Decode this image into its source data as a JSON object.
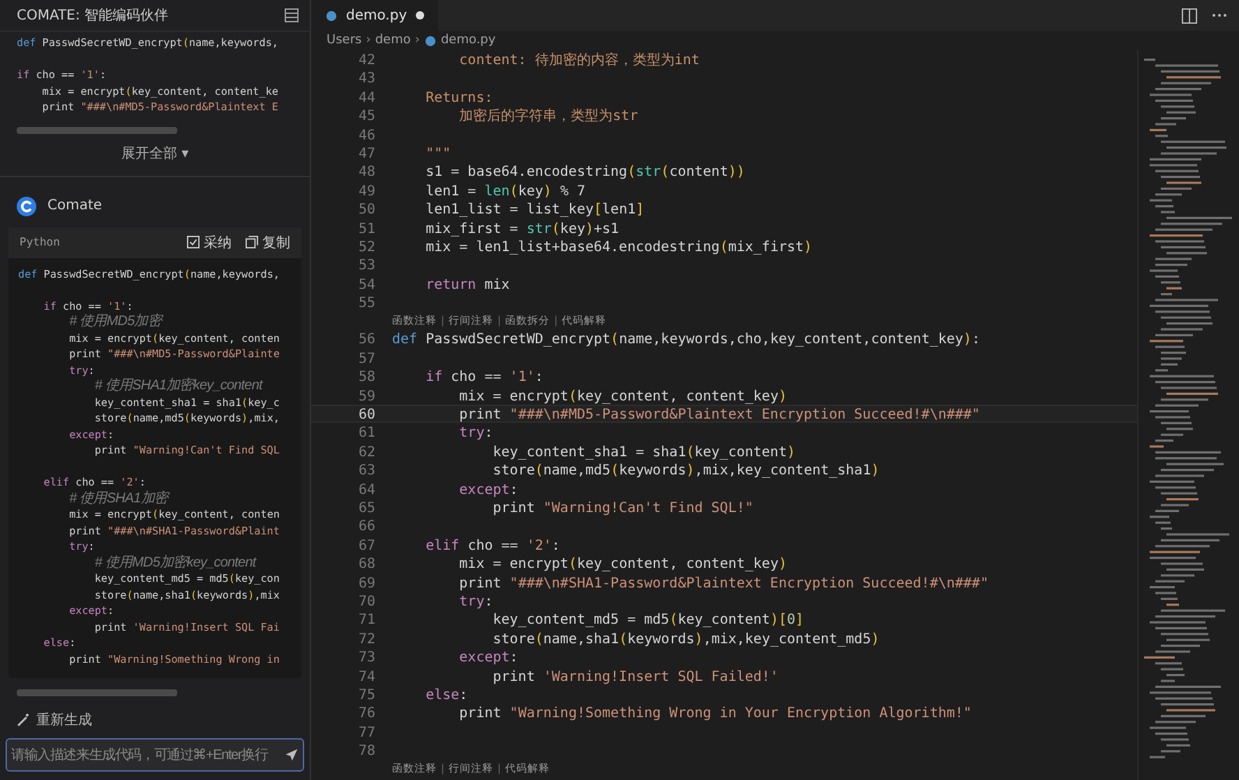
{
  "assistant_panel": {
    "title": "COMATE: 智能编码伙伴",
    "previous_snippet": [
      {
        "kind": "code",
        "tokens": [
          {
            "kind": "def",
            "text": "def"
          },
          {
            "kind": "plain",
            "text": " PasswdSecretWD_encrypt"
          },
          {
            "kind": "paren",
            "text": "("
          },
          {
            "kind": "plain",
            "text": "name,keywords,"
          }
        ]
      },
      {
        "kind": "blank"
      },
      {
        "kind": "code",
        "tokens": [
          {
            "kind": "keyword",
            "text": "if"
          },
          {
            "kind": "plain",
            "text": " cho == "
          },
          {
            "kind": "string",
            "text": "'1'"
          },
          {
            "kind": "plain",
            "text": ":"
          }
        ]
      },
      {
        "kind": "code",
        "tokens": [
          {
            "kind": "plain",
            "text": "    mix = encrypt"
          },
          {
            "kind": "paren",
            "text": "("
          },
          {
            "kind": "plain",
            "text": "key_content, content_ke"
          }
        ]
      },
      {
        "kind": "code",
        "tokens": [
          {
            "kind": "plain",
            "text": "    print "
          },
          {
            "kind": "string",
            "text": "\"###\\n#MD5-Password&Plaintext E"
          }
        ]
      }
    ],
    "expand_label": "展开全部 ▾",
    "reply": {
      "author": "Comate",
      "language": "Python",
      "accept_label": "采纳",
      "copy_label": "复制",
      "lines": [
        {
          "kind": "code",
          "tokens": [
            {
              "kind": "def",
              "text": "def"
            },
            {
              "kind": "plain",
              "text": " PasswdSecretWD_encrypt"
            },
            {
              "kind": "paren",
              "text": "("
            },
            {
              "kind": "plain",
              "text": "name,keywords,"
            }
          ]
        },
        {
          "kind": "blank"
        },
        {
          "kind": "code",
          "tokens": [
            {
              "kind": "keyword",
              "text": "    if"
            },
            {
              "kind": "plain",
              "text": " cho == "
            },
            {
              "kind": "string",
              "text": "'1'"
            },
            {
              "kind": "plain",
              "text": ":"
            }
          ]
        },
        {
          "kind": "code",
          "tokens": [
            {
              "kind": "comment",
              "text": "        # 使用MD5加密"
            }
          ]
        },
        {
          "kind": "code",
          "tokens": [
            {
              "kind": "plain",
              "text": "        mix = encrypt"
            },
            {
              "kind": "paren",
              "text": "("
            },
            {
              "kind": "plain",
              "text": "key_content, conten"
            }
          ]
        },
        {
          "kind": "code",
          "tokens": [
            {
              "kind": "plain",
              "text": "        print "
            },
            {
              "kind": "string",
              "text": "\"###\\n#MD5-Password&Plainte"
            }
          ]
        },
        {
          "kind": "code",
          "tokens": [
            {
              "kind": "keyword",
              "text": "        try"
            },
            {
              "kind": "plain",
              "text": ":"
            }
          ]
        },
        {
          "kind": "code",
          "tokens": [
            {
              "kind": "comment",
              "text": "            # 使用SHA1加密key_content"
            }
          ]
        },
        {
          "kind": "code",
          "tokens": [
            {
              "kind": "plain",
              "text": "            key_content_sha1 = sha1"
            },
            {
              "kind": "paren",
              "text": "("
            },
            {
              "kind": "plain",
              "text": "key_c"
            }
          ]
        },
        {
          "kind": "code",
          "tokens": [
            {
              "kind": "plain",
              "text": "            store"
            },
            {
              "kind": "paren",
              "text": "("
            },
            {
              "kind": "plain",
              "text": "name,md5"
            },
            {
              "kind": "paren",
              "text": "("
            },
            {
              "kind": "plain",
              "text": "keywords"
            },
            {
              "kind": "paren",
              "text": ")"
            },
            {
              "kind": "plain",
              "text": ",mix,"
            }
          ]
        },
        {
          "kind": "code",
          "tokens": [
            {
              "kind": "keyword",
              "text": "        except"
            },
            {
              "kind": "plain",
              "text": ":"
            }
          ]
        },
        {
          "kind": "code",
          "tokens": [
            {
              "kind": "plain",
              "text": "            print "
            },
            {
              "kind": "string",
              "text": "\"Warning!Can't Find SQL"
            }
          ]
        },
        {
          "kind": "blank"
        },
        {
          "kind": "code",
          "tokens": [
            {
              "kind": "keyword",
              "text": "    elif"
            },
            {
              "kind": "plain",
              "text": " cho == "
            },
            {
              "kind": "string",
              "text": "'2'"
            },
            {
              "kind": "plain",
              "text": ":"
            }
          ]
        },
        {
          "kind": "code",
          "tokens": [
            {
              "kind": "comment",
              "text": "        # 使用SHA1加密"
            }
          ]
        },
        {
          "kind": "code",
          "tokens": [
            {
              "kind": "plain",
              "text": "        mix = encrypt"
            },
            {
              "kind": "paren",
              "text": "("
            },
            {
              "kind": "plain",
              "text": "key_content, conten"
            }
          ]
        },
        {
          "kind": "code",
          "tokens": [
            {
              "kind": "plain",
              "text": "        print "
            },
            {
              "kind": "string",
              "text": "\"###\\n#SHA1-Password&Plaint"
            }
          ]
        },
        {
          "kind": "code",
          "tokens": [
            {
              "kind": "keyword",
              "text": "        try"
            },
            {
              "kind": "plain",
              "text": ":"
            }
          ]
        },
        {
          "kind": "code",
          "tokens": [
            {
              "kind": "comment",
              "text": "            # 使用MD5加密key_content"
            }
          ]
        },
        {
          "kind": "code",
          "tokens": [
            {
              "kind": "plain",
              "text": "            key_content_md5 = md5"
            },
            {
              "kind": "paren",
              "text": "("
            },
            {
              "kind": "plain",
              "text": "key_con"
            }
          ]
        },
        {
          "kind": "code",
          "tokens": [
            {
              "kind": "plain",
              "text": "            store"
            },
            {
              "kind": "paren",
              "text": "("
            },
            {
              "kind": "plain",
              "text": "name,sha1"
            },
            {
              "kind": "paren",
              "text": "("
            },
            {
              "kind": "plain",
              "text": "keywords"
            },
            {
              "kind": "paren",
              "text": ")"
            },
            {
              "kind": "plain",
              "text": ",mix"
            }
          ]
        },
        {
          "kind": "code",
          "tokens": [
            {
              "kind": "keyword",
              "text": "        except"
            },
            {
              "kind": "plain",
              "text": ":"
            }
          ]
        },
        {
          "kind": "code",
          "tokens": [
            {
              "kind": "plain",
              "text": "            print "
            },
            {
              "kind": "string",
              "text": "'Warning!Insert SQL Fai"
            }
          ]
        },
        {
          "kind": "code",
          "tokens": [
            {
              "kind": "keyword",
              "text": "    else"
            },
            {
              "kind": "plain",
              "text": ":"
            }
          ]
        },
        {
          "kind": "code",
          "tokens": [
            {
              "kind": "plain",
              "text": "        print "
            },
            {
              "kind": "string",
              "text": "\"Warning!Something Wrong in"
            }
          ]
        }
      ]
    },
    "regenerate_label": "重新生成",
    "prompt": {
      "placeholder": "请输入描述来生成代码，可通过⌘+Enter换行"
    }
  },
  "editor": {
    "tabs": [
      {
        "label": "demo.py",
        "modified": true,
        "selected": true
      }
    ],
    "breadcrumb": {
      "separator": "›",
      "items": [
        "Users",
        "demo",
        "demo.py"
      ]
    },
    "lines": [
      {
        "kind": "code",
        "number": "42",
        "current": false,
        "tokens": [
          {
            "kind": "doc",
            "text": "        content: 待加密的内容，类型为int"
          }
        ]
      },
      {
        "kind": "code",
        "number": "43",
        "current": false
      },
      {
        "kind": "code",
        "number": "44",
        "current": false,
        "tokens": [
          {
            "kind": "doc",
            "text": "    Returns:"
          }
        ]
      },
      {
        "kind": "code",
        "number": "45",
        "current": false,
        "tokens": [
          {
            "kind": "doc",
            "text": "        加密后的字符串，类型为str"
          }
        ]
      },
      {
        "kind": "code",
        "number": "46",
        "current": false
      },
      {
        "kind": "code",
        "number": "47",
        "current": false,
        "tokens": [
          {
            "kind": "doc",
            "text": "    \"\"\""
          }
        ]
      },
      {
        "kind": "code",
        "number": "48",
        "current": false,
        "tokens": [
          {
            "kind": "plain",
            "text": "    s1 = base64.encodestring"
          },
          {
            "kind": "paren",
            "text": "("
          },
          {
            "kind": "builtin",
            "text": "str"
          },
          {
            "kind": "paren",
            "text": "("
          },
          {
            "kind": "plain",
            "text": "content"
          },
          {
            "kind": "paren",
            "text": "))"
          }
        ]
      },
      {
        "kind": "code",
        "number": "49",
        "current": false,
        "tokens": [
          {
            "kind": "plain",
            "text": "    len1 = "
          },
          {
            "kind": "builtin",
            "text": "len"
          },
          {
            "kind": "paren",
            "text": "("
          },
          {
            "kind": "plain",
            "text": "key"
          },
          {
            "kind": "paren",
            "text": ")"
          },
          {
            "kind": "plain",
            "text": " % 7"
          }
        ]
      },
      {
        "kind": "code",
        "number": "50",
        "current": false,
        "tokens": [
          {
            "kind": "plain",
            "text": "    len1_list = list_key"
          },
          {
            "kind": "paren",
            "text": "["
          },
          {
            "kind": "plain",
            "text": "len1"
          },
          {
            "kind": "paren",
            "text": "]"
          }
        ]
      },
      {
        "kind": "code",
        "number": "51",
        "current": false,
        "tokens": [
          {
            "kind": "plain",
            "text": "    mix_first = "
          },
          {
            "kind": "builtin",
            "text": "str"
          },
          {
            "kind": "paren",
            "text": "("
          },
          {
            "kind": "plain",
            "text": "key"
          },
          {
            "kind": "paren",
            "text": ")"
          },
          {
            "kind": "plain",
            "text": "+s1"
          }
        ]
      },
      {
        "kind": "code",
        "number": "52",
        "current": false,
        "tokens": [
          {
            "kind": "plain",
            "text": "    mix = len1_list+base64.encodestring"
          },
          {
            "kind": "paren",
            "text": "("
          },
          {
            "kind": "plain",
            "text": "mix_first"
          },
          {
            "kind": "paren",
            "text": ")"
          }
        ]
      },
      {
        "kind": "code",
        "number": "53",
        "current": false
      },
      {
        "kind": "code",
        "number": "54",
        "current": false,
        "tokens": [
          {
            "kind": "keyword",
            "text": "    return"
          },
          {
            "kind": "plain",
            "text": " mix"
          }
        ]
      },
      {
        "kind": "code",
        "number": "55",
        "current": false
      },
      {
        "kind": "codelens",
        "separator": "|",
        "actions": [
          "函数注释",
          "行间注释",
          "函数拆分",
          "代码解释"
        ]
      },
      {
        "kind": "code",
        "number": "56",
        "current": false,
        "tokens": [
          {
            "kind": "def",
            "text": "def"
          },
          {
            "kind": "plain",
            "text": " PasswdSecretWD_encrypt"
          },
          {
            "kind": "paren",
            "text": "("
          },
          {
            "kind": "plain",
            "text": "name,keywords,cho,key_content,content_key"
          },
          {
            "kind": "paren",
            "text": ")"
          },
          {
            "kind": "plain",
            "text": ":"
          }
        ]
      },
      {
        "kind": "code",
        "number": "57",
        "current": false
      },
      {
        "kind": "code",
        "number": "58",
        "current": false,
        "tokens": [
          {
            "kind": "keyword",
            "text": "    if"
          },
          {
            "kind": "plain",
            "text": " cho == "
          },
          {
            "kind": "string",
            "text": "'1'"
          },
          {
            "kind": "plain",
            "text": ":"
          }
        ]
      },
      {
        "kind": "code",
        "number": "59",
        "current": false,
        "tokens": [
          {
            "kind": "plain",
            "text": "        mix = encrypt"
          },
          {
            "kind": "paren",
            "text": "("
          },
          {
            "kind": "plain",
            "text": "key_content, content_key"
          },
          {
            "kind": "paren",
            "text": ")"
          }
        ]
      },
      {
        "kind": "code",
        "number": "60",
        "current": true,
        "tokens": [
          {
            "kind": "plain",
            "text": "        print "
          },
          {
            "kind": "string",
            "text": "\"###\\n#MD5-Password&Plaintext Encryption Succeed!#\\n###\""
          }
        ]
      },
      {
        "kind": "code",
        "number": "61",
        "current": false,
        "tokens": [
          {
            "kind": "keyword",
            "text": "        try"
          },
          {
            "kind": "plain",
            "text": ":"
          }
        ]
      },
      {
        "kind": "code",
        "number": "62",
        "current": false,
        "tokens": [
          {
            "kind": "plain",
            "text": "            key_content_sha1 = sha1"
          },
          {
            "kind": "paren",
            "text": "("
          },
          {
            "kind": "plain",
            "text": "key_content"
          },
          {
            "kind": "paren",
            "text": ")"
          }
        ]
      },
      {
        "kind": "code",
        "number": "63",
        "current": false,
        "tokens": [
          {
            "kind": "plain",
            "text": "            store"
          },
          {
            "kind": "paren",
            "text": "("
          },
          {
            "kind": "plain",
            "text": "name,md5"
          },
          {
            "kind": "paren",
            "text": "("
          },
          {
            "kind": "plain",
            "text": "keywords"
          },
          {
            "kind": "paren",
            "text": ")"
          },
          {
            "kind": "plain",
            "text": ",mix,key_content_sha1"
          },
          {
            "kind": "paren",
            "text": ")"
          }
        ]
      },
      {
        "kind": "code",
        "number": "64",
        "current": false,
        "tokens": [
          {
            "kind": "keyword",
            "text": "        except"
          },
          {
            "kind": "plain",
            "text": ":"
          }
        ]
      },
      {
        "kind": "code",
        "number": "65",
        "current": false,
        "tokens": [
          {
            "kind": "plain",
            "text": "            print "
          },
          {
            "kind": "string",
            "text": "\"Warning!Can't Find SQL!\""
          }
        ]
      },
      {
        "kind": "code",
        "number": "66",
        "current": false
      },
      {
        "kind": "code",
        "number": "67",
        "current": false,
        "tokens": [
          {
            "kind": "keyword",
            "text": "    elif"
          },
          {
            "kind": "plain",
            "text": " cho == "
          },
          {
            "kind": "string",
            "text": "'2'"
          },
          {
            "kind": "plain",
            "text": ":"
          }
        ]
      },
      {
        "kind": "code",
        "number": "68",
        "current": false,
        "tokens": [
          {
            "kind": "plain",
            "text": "        mix = encrypt"
          },
          {
            "kind": "paren",
            "text": "("
          },
          {
            "kind": "plain",
            "text": "key_content, content_key"
          },
          {
            "kind": "paren",
            "text": ")"
          }
        ]
      },
      {
        "kind": "code",
        "number": "69",
        "current": false,
        "tokens": [
          {
            "kind": "plain",
            "text": "        print "
          },
          {
            "kind": "string",
            "text": "\"###\\n#SHA1-Password&Plaintext Encryption Succeed!#\\n###\""
          }
        ]
      },
      {
        "kind": "code",
        "number": "70",
        "current": false,
        "tokens": [
          {
            "kind": "keyword",
            "text": "        try"
          },
          {
            "kind": "plain",
            "text": ":"
          }
        ]
      },
      {
        "kind": "code",
        "number": "71",
        "current": false,
        "tokens": [
          {
            "kind": "plain",
            "text": "            key_content_md5 = md5"
          },
          {
            "kind": "paren",
            "text": "("
          },
          {
            "kind": "plain",
            "text": "key_content"
          },
          {
            "kind": "paren",
            "text": ")["
          },
          {
            "kind": "number",
            "text": "0"
          },
          {
            "kind": "paren",
            "text": "]"
          }
        ]
      },
      {
        "kind": "code",
        "number": "72",
        "current": false,
        "tokens": [
          {
            "kind": "plain",
            "text": "            store"
          },
          {
            "kind": "paren",
            "text": "("
          },
          {
            "kind": "plain",
            "text": "name,sha1"
          },
          {
            "kind": "paren",
            "text": "("
          },
          {
            "kind": "plain",
            "text": "keywords"
          },
          {
            "kind": "paren",
            "text": ")"
          },
          {
            "kind": "plain",
            "text": ",mix,key_content_md5"
          },
          {
            "kind": "paren",
            "text": ")"
          }
        ]
      },
      {
        "kind": "code",
        "number": "73",
        "current": false,
        "tokens": [
          {
            "kind": "keyword",
            "text": "        except"
          },
          {
            "kind": "plain",
            "text": ":"
          }
        ]
      },
      {
        "kind": "code",
        "number": "74",
        "current": false,
        "tokens": [
          {
            "kind": "plain",
            "text": "            print "
          },
          {
            "kind": "string",
            "text": "'Warning!Insert SQL Failed!'"
          }
        ]
      },
      {
        "kind": "code",
        "number": "75",
        "current": false,
        "tokens": [
          {
            "kind": "keyword",
            "text": "    else"
          },
          {
            "kind": "plain",
            "text": ":"
          }
        ]
      },
      {
        "kind": "code",
        "number": "76",
        "current": false,
        "tokens": [
          {
            "kind": "plain",
            "text": "        print "
          },
          {
            "kind": "string",
            "text": "\"Warning!Something Wrong in Your Encryption Algorithm!\""
          }
        ]
      },
      {
        "kind": "code",
        "number": "77",
        "current": false
      },
      {
        "kind": "code",
        "number": "78",
        "current": false
      },
      {
        "kind": "codelens",
        "separator": "|",
        "actions": [
          "函数注释",
          "行间注释",
          "代码解释"
        ]
      }
    ]
  }
}
